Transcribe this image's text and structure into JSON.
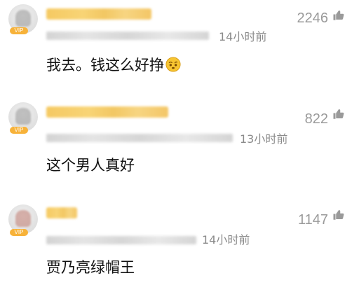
{
  "comments": [
    {
      "likes": "2246",
      "time": "14小时前",
      "text": "我去。钱这么好挣",
      "badge": "VIP",
      "emoji": "dizzy-face-emoji"
    },
    {
      "likes": "822",
      "time": "13小时前",
      "text": "这个男人真好",
      "badge": "VIP"
    },
    {
      "likes": "1147",
      "time": "14小时前",
      "text": "贾乃亮绿帽王",
      "badge": "VIP"
    }
  ],
  "colors": {
    "username_gold": "#f5c75a",
    "badge": "#f7b239",
    "meta_gray": "#8a8a8a",
    "likes_gray": "#9a9a9a"
  }
}
